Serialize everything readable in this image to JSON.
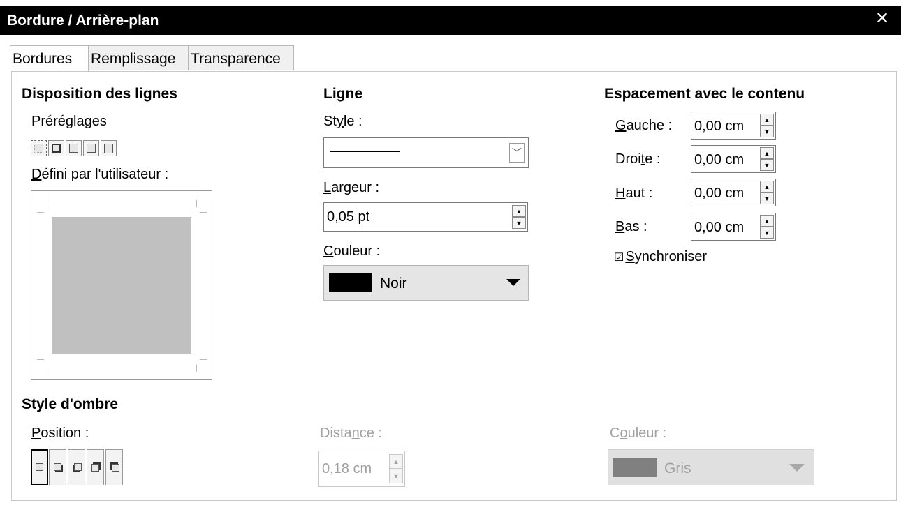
{
  "window": {
    "title": "Bordure / Arrière-plan",
    "close_symbol": "✕"
  },
  "tabs": [
    "Bordures",
    "Remplissage",
    "Transparence"
  ],
  "line_arrangement": {
    "heading": "Disposition des lignes",
    "presets_label": "Préréglages",
    "user_defined_label": "Défini par l'utilisateur :"
  },
  "line": {
    "heading": "Ligne",
    "style_label": "Style :",
    "width_label": "Largeur :",
    "width_value": "0,05 pt",
    "color_label": "Couleur :",
    "color_value": "Noir",
    "color_swatch": "#000000"
  },
  "padding": {
    "heading": "Espacement avec le contenu",
    "left_label": "Gauche :",
    "left_value": "0,00 cm",
    "right_label": "Droite :",
    "right_value": "0,00 cm",
    "top_label": "Haut :",
    "top_value": "0,00 cm",
    "bottom_label": "Bas :",
    "bottom_value": "0,00 cm",
    "sync_label": "Synchroniser",
    "sync_symbol": "☑"
  },
  "shadow": {
    "heading": "Style d'ombre",
    "position_label": "Position :",
    "distance_label": "Distance :",
    "distance_value": "0,18 cm",
    "color_label": "Couleur :",
    "color_value": "Gris",
    "color_swatch": "#808080"
  },
  "colors": {
    "accent": "#000000",
    "preview_fill": "#c0c0c0"
  }
}
